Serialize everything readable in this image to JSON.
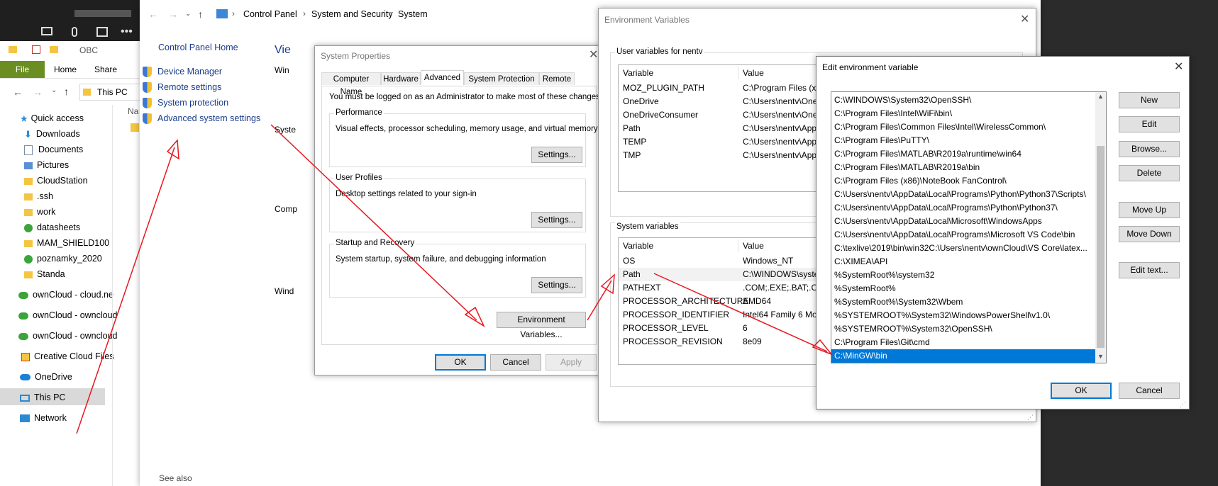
{
  "taskbar_dark": {
    "buttons": [
      "camera-off-icon",
      "mic-off-icon",
      "share-icon",
      "more-icon"
    ]
  },
  "explorer": {
    "title": "OBC",
    "ribbon_tabs": [
      "File",
      "Home",
      "Share"
    ],
    "address": "This PC",
    "nav_items": [
      {
        "label": "Quick access",
        "icon": "star"
      },
      {
        "label": "Downloads",
        "icon": "download",
        "pinned": true
      },
      {
        "label": "Documents",
        "icon": "doc",
        "pinned": true
      },
      {
        "label": "Pictures",
        "icon": "pic",
        "pinned": true
      },
      {
        "label": "CloudStation",
        "icon": "folder",
        "pinned": true
      },
      {
        "label": ".ssh",
        "icon": "folder",
        "pinned": true
      },
      {
        "label": "work",
        "icon": "folder",
        "pinned": true
      },
      {
        "label": "datasheets",
        "icon": "folder-sync"
      },
      {
        "label": "MAM_SHIELD100",
        "icon": "folder"
      },
      {
        "label": "poznamky_2020",
        "icon": "folder-sync"
      },
      {
        "label": "Standa",
        "icon": "folder"
      },
      {
        "label": "ownCloud - cloud.ne",
        "icon": "cloud-green"
      },
      {
        "label": "ownCloud - owncloud",
        "icon": "cloud-green"
      },
      {
        "label": "ownCloud - owncloud",
        "icon": "cloud-green"
      },
      {
        "label": "Creative Cloud Files",
        "icon": "cc"
      },
      {
        "label": "OneDrive",
        "icon": "onedrive"
      },
      {
        "label": "This PC",
        "icon": "pc"
      },
      {
        "label": "Network",
        "icon": "network"
      }
    ],
    "content_col": "Na"
  },
  "control_panel": {
    "breadcrumb": [
      "Control Panel",
      "System and Security",
      "System"
    ],
    "home_link": "Control Panel Home",
    "links": [
      "Device Manager",
      "Remote settings",
      "System protection",
      "Advanced system settings"
    ],
    "view_label": "Vie",
    "side_labels": [
      "Win",
      "Syste",
      "Comp",
      "Wind"
    ],
    "see_also": "See also"
  },
  "system_properties": {
    "title": "System Properties",
    "tabs": [
      "Computer Name",
      "Hardware",
      "Advanced",
      "System Protection",
      "Remote"
    ],
    "admin_note": "You must be logged on as an Administrator to make most of these changes.",
    "groups": [
      {
        "title": "Performance",
        "desc": "Visual effects, processor scheduling, memory usage, and virtual memory",
        "button": "Settings..."
      },
      {
        "title": "User Profiles",
        "desc": "Desktop settings related to your sign-in",
        "button": "Settings..."
      },
      {
        "title": "Startup and Recovery",
        "desc": "System startup, system failure, and debugging information",
        "button": "Settings..."
      }
    ],
    "env_button": "Environment Variables...",
    "ok": "OK",
    "cancel": "Cancel",
    "apply": "Apply"
  },
  "env_vars": {
    "title": "Environment Variables",
    "user_label": "User variables for nentv",
    "col_variable": "Variable",
    "col_value": "Value",
    "user_rows": [
      {
        "name": "MOZ_PLUGIN_PATH",
        "value": "C:\\Program Files (x8"
      },
      {
        "name": "OneDrive",
        "value": "C:\\Users\\nentv\\One"
      },
      {
        "name": "OneDriveConsumer",
        "value": "C:\\Users\\nentv\\One"
      },
      {
        "name": "Path",
        "value": "C:\\Users\\nentv\\App"
      },
      {
        "name": "TEMP",
        "value": "C:\\Users\\nentv\\App"
      },
      {
        "name": "TMP",
        "value": "C:\\Users\\nentv\\App"
      }
    ],
    "system_label": "System variables",
    "system_rows": [
      {
        "name": "OS",
        "value": "Windows_NT"
      },
      {
        "name": "Path",
        "value": "C:\\WINDOWS\\syster"
      },
      {
        "name": "PATHEXT",
        "value": ".COM;.EXE;.BAT;.CM"
      },
      {
        "name": "PROCESSOR_ARCHITECTURE",
        "value": "AMD64"
      },
      {
        "name": "PROCESSOR_IDENTIFIER",
        "value": "Intel64 Family 6 Mod"
      },
      {
        "name": "PROCESSOR_LEVEL",
        "value": "6"
      },
      {
        "name": "PROCESSOR_REVISION",
        "value": "8e09"
      }
    ]
  },
  "edit_env": {
    "title": "Edit environment variable",
    "entries": [
      "C:\\WINDOWS\\System32\\OpenSSH\\",
      "C:\\Program Files\\Intel\\WiFi\\bin\\",
      "C:\\Program Files\\Common Files\\Intel\\WirelessCommon\\",
      "C:\\Program Files\\PuTTY\\",
      "C:\\Program Files\\MATLAB\\R2019a\\runtime\\win64",
      "C:\\Program Files\\MATLAB\\R2019a\\bin",
      "C:\\Program Files (x86)\\NoteBook FanControl\\",
      "C:\\Users\\nentv\\AppData\\Local\\Programs\\Python\\Python37\\Scripts\\",
      "C:\\Users\\nentv\\AppData\\Local\\Programs\\Python\\Python37\\",
      "C:\\Users\\nentv\\AppData\\Local\\Microsoft\\WindowsApps",
      "C:\\Users\\nentv\\AppData\\Local\\Programs\\Microsoft VS Code\\bin",
      "C:\\texlive\\2019\\bin\\win32C:\\Users\\nentv\\ownCloud\\VS Core\\latex...",
      "C:\\XIMEA\\API",
      "%SystemRoot%\\system32",
      "%SystemRoot%",
      "%SystemRoot%\\System32\\Wbem",
      "%SYSTEMROOT%\\System32\\WindowsPowerShell\\v1.0\\",
      "%SYSTEMROOT%\\System32\\OpenSSH\\",
      "C:\\Program Files\\Git\\cmd",
      "C:\\MinGW\\bin"
    ],
    "selected_entry": "C:\\MinGW\\bin",
    "buttons": [
      "New",
      "Edit",
      "Browse...",
      "Delete",
      "Move Up",
      "Move Down",
      "Edit text..."
    ],
    "ok": "OK",
    "cancel": "Cancel"
  },
  "colors": {
    "selection": "#0078d7",
    "annotation": "#e8171f",
    "file_tab": "#6b8e23",
    "link": "#1a3c8a"
  }
}
